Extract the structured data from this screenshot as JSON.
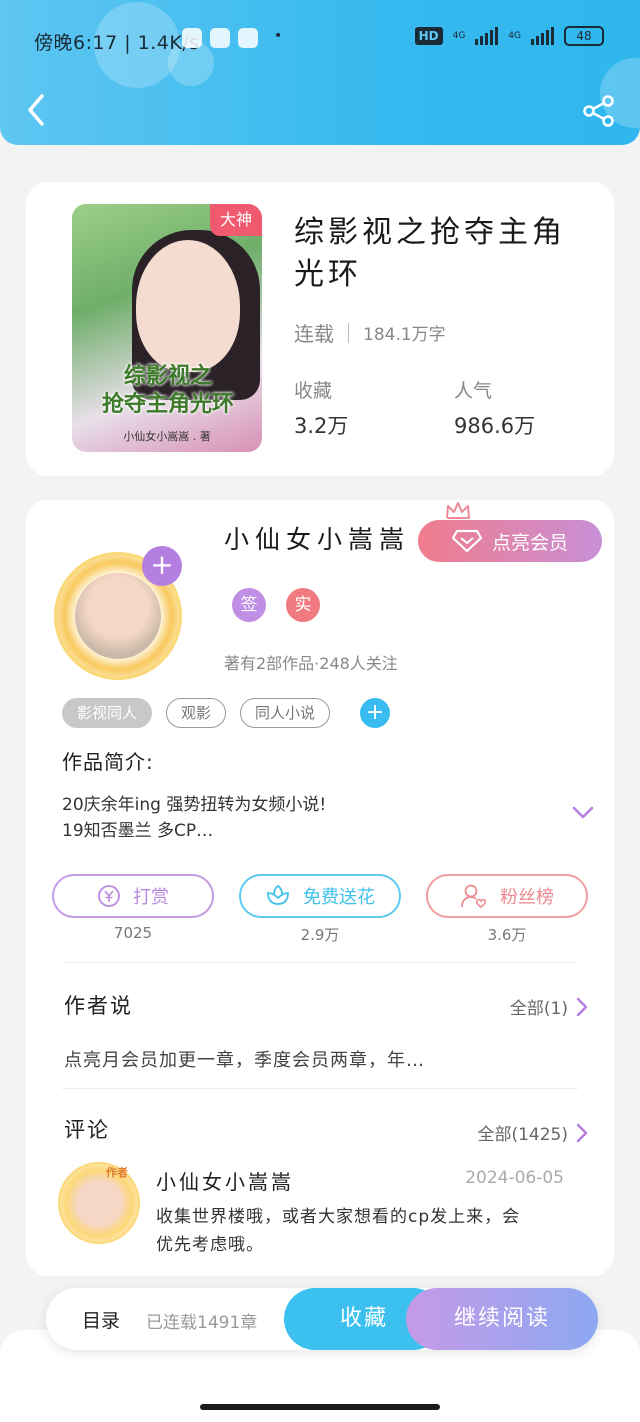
{
  "status_bar": {
    "time_speed": "傍晚6:17 | 1.4K/s",
    "dot": "•",
    "hd": "HD",
    "net1": "4G",
    "net2": "4G",
    "battery": "48"
  },
  "book": {
    "cover_badge": "大神",
    "cover_title_line1": "综影视之",
    "cover_title_line2": "抢夺主角光环",
    "cover_author": "小仙女小嵩嵩 . 著",
    "title": "综影视之抢夺主角光环",
    "status": "连载",
    "word_count": "184.1万字",
    "favorites_label": "收藏",
    "favorites_value": "3.2万",
    "popularity_label": "人气",
    "popularity_value": "986.6万"
  },
  "author": {
    "name": "小仙女小嵩嵩",
    "vip_button": "点亮会员",
    "badge_signed": "签",
    "badge_real": "实",
    "stats": "著有2部作品·248人关注",
    "avatar_plus": "+"
  },
  "tags": [
    "影视同人",
    "观影",
    "同人小说"
  ],
  "tag_add": "+",
  "intro": {
    "heading": "作品简介:",
    "line1": "20庆余年ing 强势扭转为女频小说!",
    "line2": "19知否墨兰 多CP…"
  },
  "actions": [
    {
      "label": "打赏",
      "count": "7025",
      "color": "#b98be0"
    },
    {
      "label": "免费送花",
      "count": "2.9万",
      "color": "#3fc1ec"
    },
    {
      "label": "粉丝榜",
      "count": "3.6万",
      "color": "#ec8a8f"
    }
  ],
  "author_says": {
    "title": "作者说",
    "more": "全部(1)",
    "text": "点亮月会员加更一章，季度会员两章，年…"
  },
  "comments": {
    "title": "评论",
    "more": "全部(1425)",
    "avatar_tag": "作者",
    "items": [
      {
        "name": "小仙女小嵩嵩",
        "date": "2024-06-05",
        "line1": "收集世界楼哦，或者大家想看的cp发上来，会",
        "line2": "优先考虑哦。"
      }
    ]
  },
  "bottom_bar": {
    "toc": "目录",
    "toc_sub": "已连载1491章",
    "favorite": "收藏",
    "continue": "继续阅读"
  },
  "colors": {
    "header": "#36b9ee",
    "accent_purple": "#b47fe1",
    "accent_blue": "#3cc0f0",
    "accent_red": "#ef5a6f"
  }
}
